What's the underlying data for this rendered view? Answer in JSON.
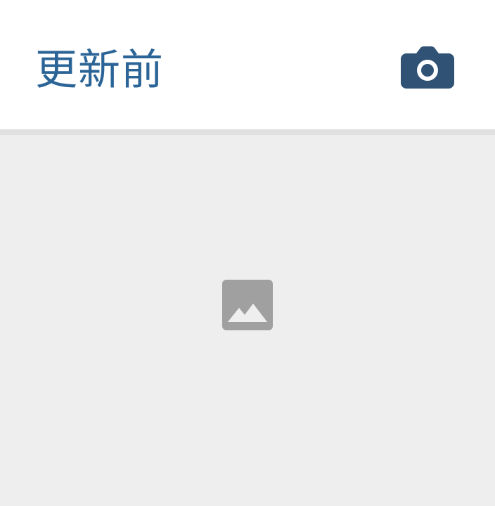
{
  "header": {
    "title": "更新前",
    "camera_icon": "camera-icon",
    "title_color": "#2b6496",
    "camera_color": "#2f5275"
  },
  "photo": {
    "placeholder_icon": "image-placeholder-icon",
    "background_color": "#eeeeee",
    "icon_color": "#a0a0a0"
  }
}
